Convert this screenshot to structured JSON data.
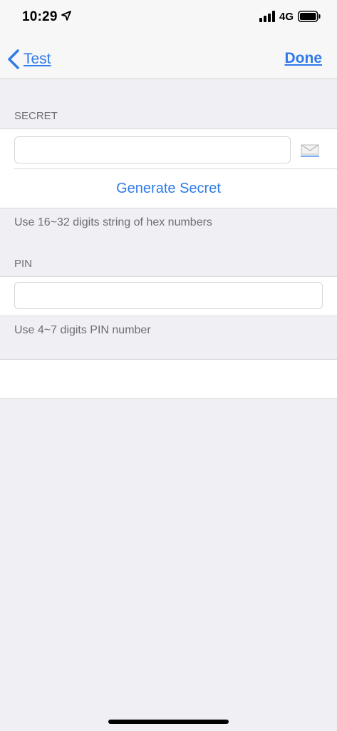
{
  "status_bar": {
    "time": "10:29",
    "network": "4G"
  },
  "nav": {
    "back_label": "Test",
    "done_label": "Done"
  },
  "secret_section": {
    "header": "SECRET",
    "input_value": "",
    "generate_label": "Generate Secret",
    "footer": "Use 16~32 digits string of hex numbers"
  },
  "pin_section": {
    "header": "PIN",
    "input_value": "",
    "footer": "Use 4~7 digits PIN number"
  },
  "colors": {
    "accent": "#2f7bea",
    "background": "#efeff4",
    "secondary_text": "#6d6d72"
  },
  "icons": [
    "location-arrow-icon",
    "signal-icon",
    "battery-icon",
    "chevron-left-icon",
    "mail-icon"
  ]
}
